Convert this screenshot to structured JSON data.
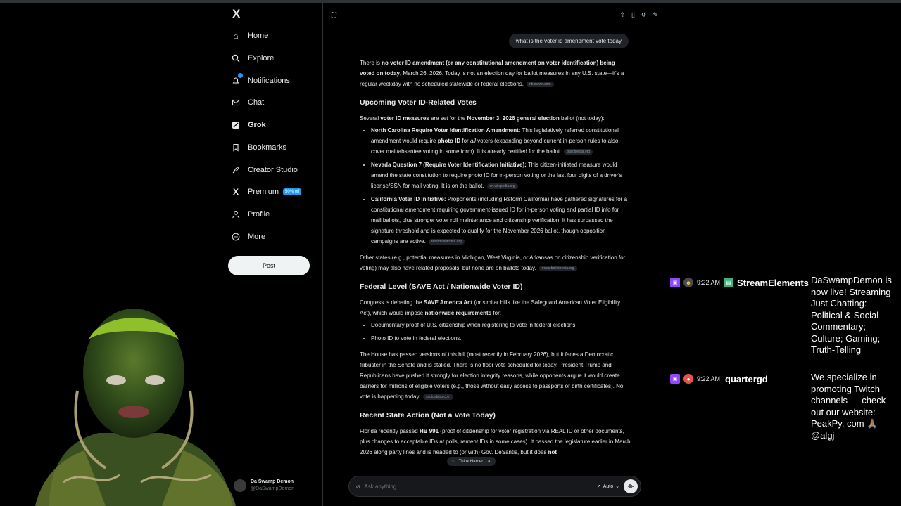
{
  "nav": {
    "logo": "X",
    "items": [
      {
        "label": "Home",
        "icon": "home-icon"
      },
      {
        "label": "Explore",
        "icon": "search-icon"
      },
      {
        "label": "Notifications",
        "icon": "bell-icon"
      },
      {
        "label": "Chat",
        "icon": "mail-icon"
      },
      {
        "label": "Grok",
        "icon": "grok-icon"
      },
      {
        "label": "Bookmarks",
        "icon": "bookmark-icon"
      },
      {
        "label": "Creator Studio",
        "icon": "rocket-icon"
      },
      {
        "label": "Premium",
        "icon": "x-icon",
        "badge": "50% off"
      },
      {
        "label": "Profile",
        "icon": "person-icon"
      },
      {
        "label": "More",
        "icon": "more-icon"
      }
    ],
    "post_label": "Post",
    "profile": {
      "name": "Da Swamp Demon",
      "handle": "@DaSwampDemon"
    }
  },
  "grok": {
    "user_question": "what is the voter id amendment vote today",
    "intro": {
      "t1": "There is ",
      "b1": "no voter ID amendment (or any constitutional amendment on voter identification) being voted on today",
      "t2": ", March 26, 2026. Today is not an election day for ballot measures in any U.S. state—it's a regular weekday with no scheduled statewide or federal elections.",
      "cite": "nbcnews.com"
    },
    "h_upcoming": "Upcoming Voter ID-Related Votes",
    "upcoming_intro": {
      "t1": "Several ",
      "b1": "voter ID measures",
      "t2": " are set for the ",
      "b2": "November 3, 2026 general election",
      "t3": " ballot (not today):"
    },
    "upcoming_items": [
      {
        "b": "North Carolina Require Voter Identification Amendment:",
        "t1": " This legislatively referred constitutional amendment would require ",
        "b2": "photo ID",
        "t2": " for ",
        "i": "all",
        "t3": " voters (expanding beyond current in-person rules to also cover mail/absentee voting in some form). It is already certified for the ballot.",
        "cite": "ballotpedia.org"
      },
      {
        "b": "Nevada Question 7 (Require Voter Identification Initiative):",
        "t1": " This citizen-initiated measure would amend the state constitution to require photo ID for in-person voting or the last four digits of a driver's license/SSN for mail voting. It is on the ballot.",
        "cite": "en.wikipedia.org"
      },
      {
        "b": "California Voter ID Initiative:",
        "t1": " Proponents (including Reform California) have gathered signatures for a constitutional amendment requiring government-issued ID for in-person voting and partial ID info for mail ballots, plus stronger voter roll maintenance and citizenship verification. It has surpassed the signature threshold and is expected to qualify for the November 2026 ballot, though opposition campaigns are active.",
        "cite": "reformcalifornia.org"
      }
    ],
    "other_states": {
      "t1": "Other states (e.g., potential measures in Michigan, West Virginia, or Arkansas on citizenship verification for voting) may also have related proposals, but none are on ballots today.",
      "cite": "news.ballotpedia.org"
    },
    "h_federal": "Federal Level (SAVE Act / Nationwide Voter ID)",
    "federal_intro": {
      "t1": "Congress is debating the ",
      "b1": "SAVE America Act",
      "t2": " (or similar bills like the Safeguard American Voter Eligibility Act), which would impose ",
      "b2": "nationwide requirements",
      "t3": " for:"
    },
    "federal_items": [
      "Documentary proof of U.S. citizenship when registering to vote in federal elections.",
      "Photo ID to vote in federal elections."
    ],
    "federal_status": {
      "t1": "The House has passed versions of this bill (most recently in February 2026), but it faces a Democratic filibuster in the Senate and is stalled. There is no floor vote scheduled for today. President Trump and Republicans have pushed it strongly for election integrity reasons, while opponents argue it would create barriers for millions of eligible voters (e.g., those without easy access to passports or birth certificates). No vote is happening today.",
      "cite": "scotusblog.com"
    },
    "h_state": "Recent State Action (Not a Vote Today)",
    "state_action": {
      "t1": "Florida recently passed ",
      "b1": "HB 991",
      "t2": " (proof of citizenship for voter registration via REAL ID or other documents, plus changes to acceptable IDs at polls, re",
      "t3": "ment IDs in some cases). It passed the legislature earlier in March 2026 along party lines and is headed to (or with) Gov. DeSantis, but it does ",
      "b2": "not"
    },
    "think_harder": "Think Harder",
    "ask_placeholder": "Ask anything",
    "mode": "Auto"
  },
  "chat": [
    {
      "time": "9:22 AM",
      "user": "StreamElements",
      "text": "DaSwampDemon is now live! Streaming Just Chatting: Political & Social Commentary; Culture; Gaming; Truth-Telling"
    },
    {
      "time": "9:22 AM",
      "user": "quartergd",
      "text": "We specialize in promoting Twitch channels — check out our website: PeakPy. com 🙏🏽 @algj"
    }
  ],
  "colors": {
    "accent": "#1d9bf0",
    "twitch": "#9146ff",
    "background": "#000000"
  }
}
